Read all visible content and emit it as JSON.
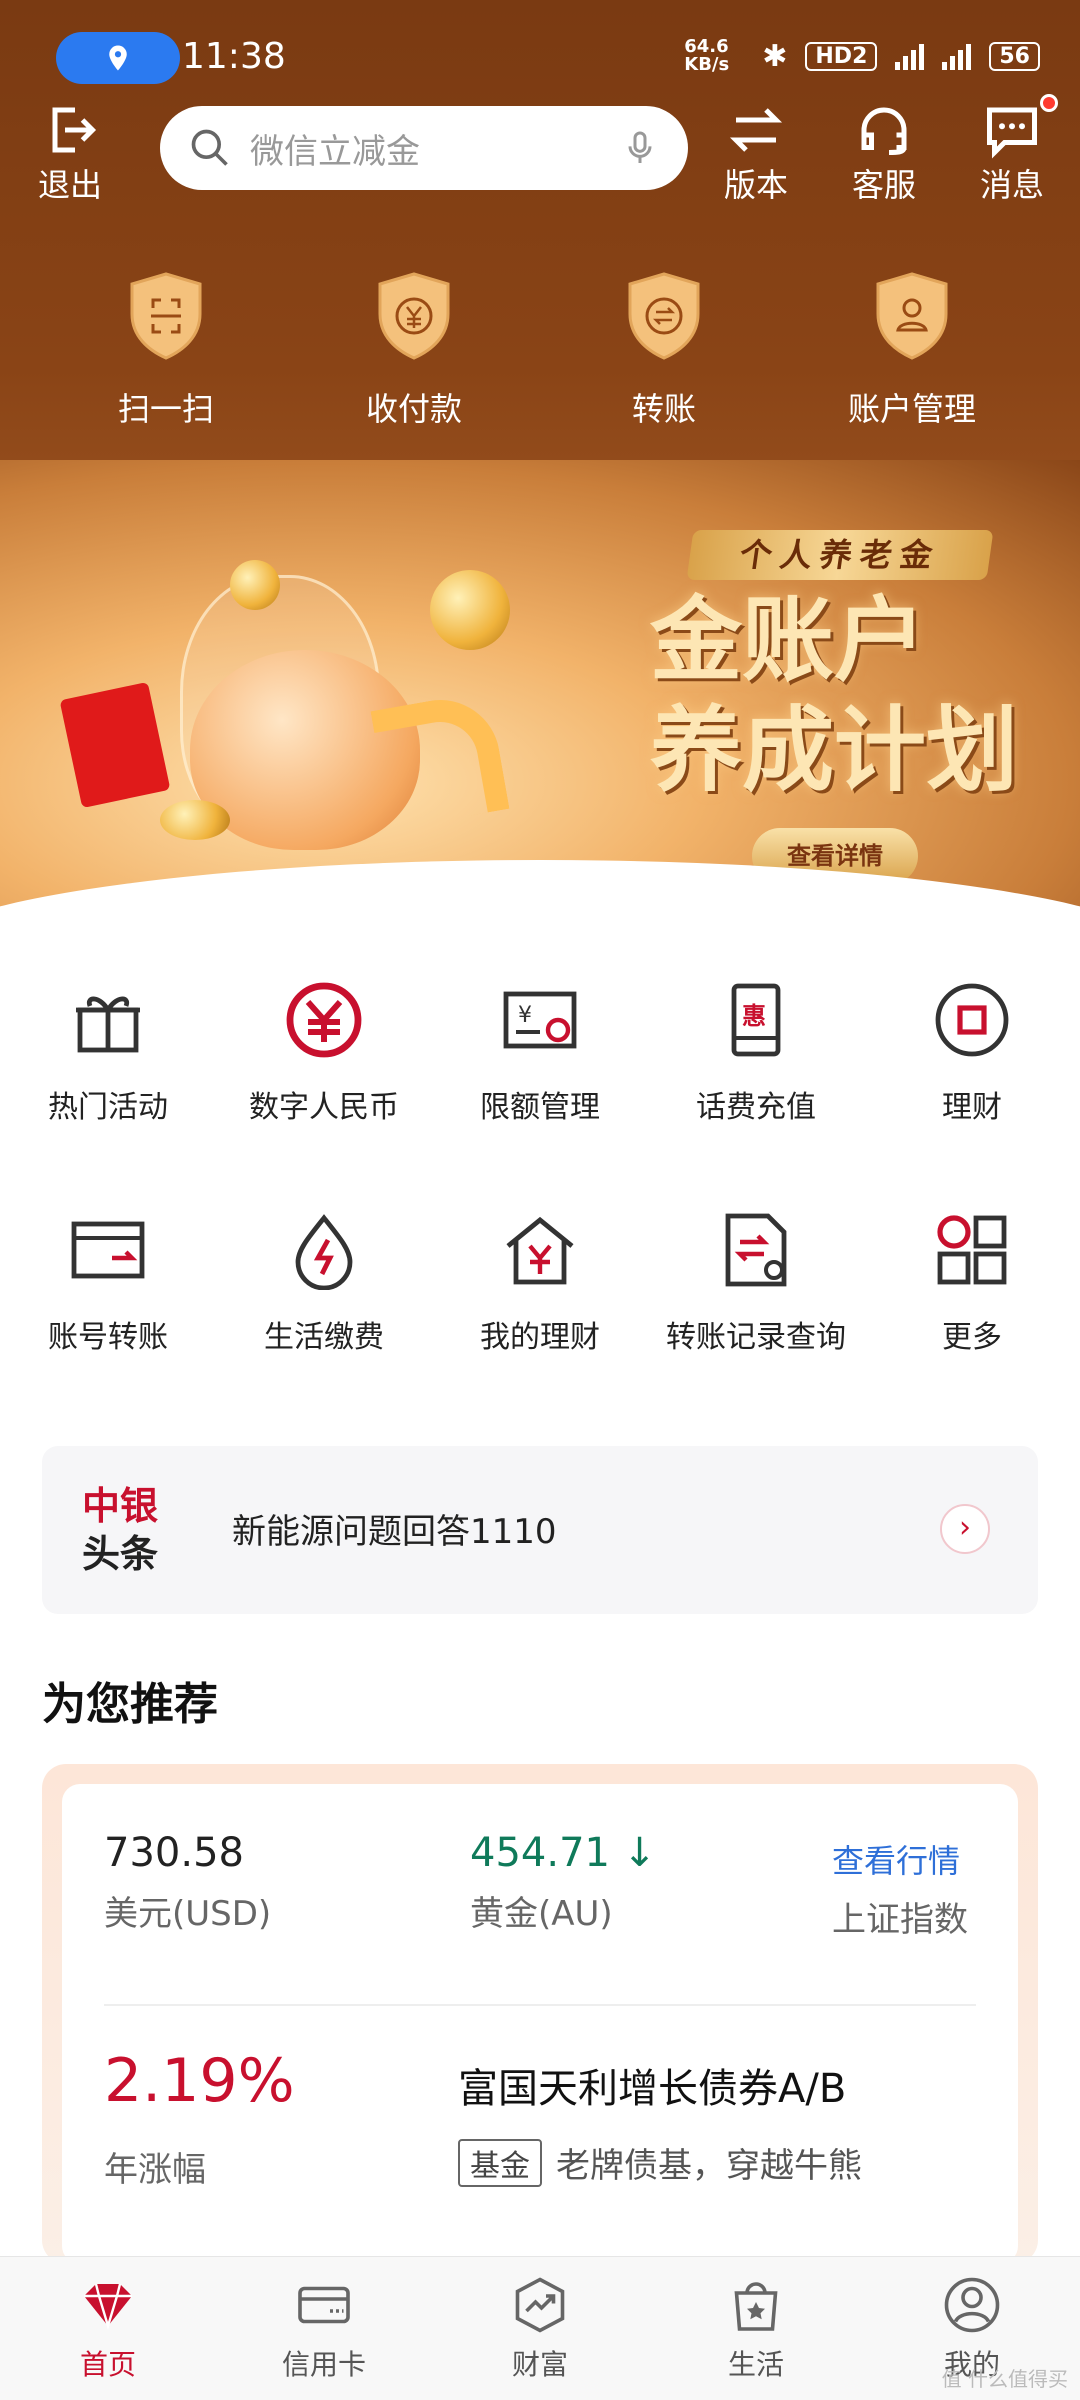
{
  "status_bar": {
    "time": "11:38",
    "net_speed": "64.6 KB/s",
    "hd_label": "HD2",
    "battery": "56",
    "location_icon": "location-pin-icon"
  },
  "topbar": {
    "exit_label": "退出",
    "search_placeholder": "微信立减金",
    "version_label": "版本",
    "service_label": "客服",
    "message_label": "消息"
  },
  "quick_actions": [
    {
      "label": "扫一扫",
      "icon": "scan-icon"
    },
    {
      "label": "收付款",
      "icon": "yuan-payment-icon"
    },
    {
      "label": "转账",
      "icon": "transfer-icon"
    },
    {
      "label": "账户管理",
      "icon": "account-user-icon"
    }
  ],
  "banner": {
    "ribbon": "个人养老金",
    "title_line1": "金账户",
    "title_line2": "养成计划",
    "button": "查看详情"
  },
  "services_row1": [
    {
      "label": "热门活动",
      "icon": "gift-icon"
    },
    {
      "label": "数字人民币",
      "icon": "digital-rmb-icon"
    },
    {
      "label": "限额管理",
      "icon": "limit-card-icon"
    },
    {
      "label": "话费充值",
      "icon": "phone-topup-icon"
    },
    {
      "label": "理财",
      "icon": "wealth-circle-icon"
    }
  ],
  "services_row2": [
    {
      "label": "账号转账",
      "icon": "account-transfer-icon"
    },
    {
      "label": "生活缴费",
      "icon": "utility-drop-icon"
    },
    {
      "label": "我的理财",
      "icon": "house-yuan-icon"
    },
    {
      "label": "转账记录查询",
      "icon": "transfer-record-icon"
    },
    {
      "label": "更多",
      "icon": "more-grid-icon"
    }
  ],
  "news": {
    "logo_line1": "中银",
    "logo_line2": "头条",
    "text": "新能源问题回答1110",
    "arrow": "›"
  },
  "recommend": {
    "title": "为您推荐",
    "markets": [
      {
        "value": "730.58",
        "name": "美元(USD)"
      },
      {
        "value": "454.71",
        "name": "黄金(AU)",
        "trend": "down"
      },
      {
        "value": "查看行情",
        "name": "上证指数"
      }
    ],
    "fund": {
      "rate": "2.19%",
      "rate_label": "年涨幅",
      "name": "富国天利增长债券A/B",
      "tag": "基金",
      "desc": "老牌债基，穿越牛熊"
    }
  },
  "bottom_nav": [
    {
      "label": "首页",
      "icon": "diamond-home-icon",
      "active": true
    },
    {
      "label": "信用卡",
      "icon": "credit-card-icon",
      "active": false
    },
    {
      "label": "财富",
      "icon": "wealth-chart-icon",
      "active": false
    },
    {
      "label": "生活",
      "icon": "life-bag-icon",
      "active": false
    },
    {
      "label": "我的",
      "icon": "profile-icon",
      "active": false
    }
  ],
  "watermark": "值 什么值得买",
  "colors": {
    "brand_red": "#c8102e",
    "header_brown": "#7a3a12",
    "gold_green": "#0f7a5a",
    "link_blue": "#2e6fd8"
  }
}
